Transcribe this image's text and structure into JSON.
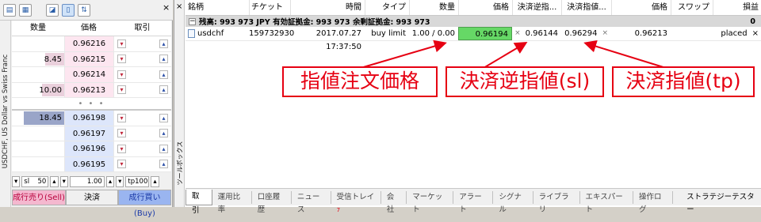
{
  "dom": {
    "symbol_label": "USDCHF, US Dollar vs Swiss Franc",
    "headers": [
      "数量",
      "価格",
      "取引"
    ],
    "ask_rows": [
      {
        "qty": "",
        "price": "0.96216",
        "level": 0
      },
      {
        "qty": "8.45",
        "price": "0.96215",
        "level": 0.36
      },
      {
        "qty": "",
        "price": "0.96214",
        "level": 0
      },
      {
        "qty": "10.00",
        "price": "0.96213",
        "level": 0.42
      }
    ],
    "bid_rows": [
      {
        "qty": "18.45",
        "price": "0.96198",
        "level": 0.78
      },
      {
        "qty": "",
        "price": "0.96197",
        "level": 0
      },
      {
        "qty": "",
        "price": "0.96196",
        "level": 0
      },
      {
        "qty": "",
        "price": "0.96195",
        "level": 0
      }
    ],
    "dots": "• • •",
    "sl_label": "sl",
    "sl_value": "50",
    "volume": "1.00",
    "tp_label": "tp",
    "tp_value": "100",
    "sell_label": "成行売り(Sell)",
    "market_label": "決済",
    "buy_label": "成行買い(Buy)"
  },
  "terminal": {
    "close": "×",
    "sidebar_label": "ツールボックス",
    "headers": [
      "銘柄",
      "チケット",
      "時間",
      "タイプ",
      "数量",
      "価格",
      "決済逆指...",
      "決済指値...",
      "価格",
      "スワップ",
      "損益"
    ],
    "balance_text": "残高: 993 973 JPY  有効証拠金: 993 973  余剰証拠金: 993 973",
    "balance_value": "0",
    "order": {
      "symbol": "usdchf",
      "ticket": "159732930",
      "time": "2017.07.27 17:37:50",
      "type": "buy limit",
      "volume": "1.00 / 0.00",
      "price": "0.96194",
      "sl": "0.96144",
      "tp": "0.96294",
      "current_price": "0.96213",
      "swap": "",
      "state": "placed"
    },
    "tabs": [
      "取引",
      "運用比率",
      "口座履歴",
      "ニュース",
      "受信トレイ",
      "会社",
      "マーケット",
      "アラート",
      "シグナル",
      "ライブラリ",
      "エキスパート",
      "操作ログ",
      "ストラテジーテスター"
    ],
    "inbox_badge": "7"
  },
  "annotations": {
    "limit_price": "指値注文価格",
    "stop_loss": "決済逆指値(sl)",
    "take_profit": "決済指値(tp)",
    "color": "#e60012"
  },
  "colors": {
    "ask_bg": "#fde6f0",
    "bid_bg": "#dde6fb",
    "ask_bar": "#ead0dc",
    "bid_bar": "#9aa5c8",
    "price_highlight": "#66d866"
  }
}
